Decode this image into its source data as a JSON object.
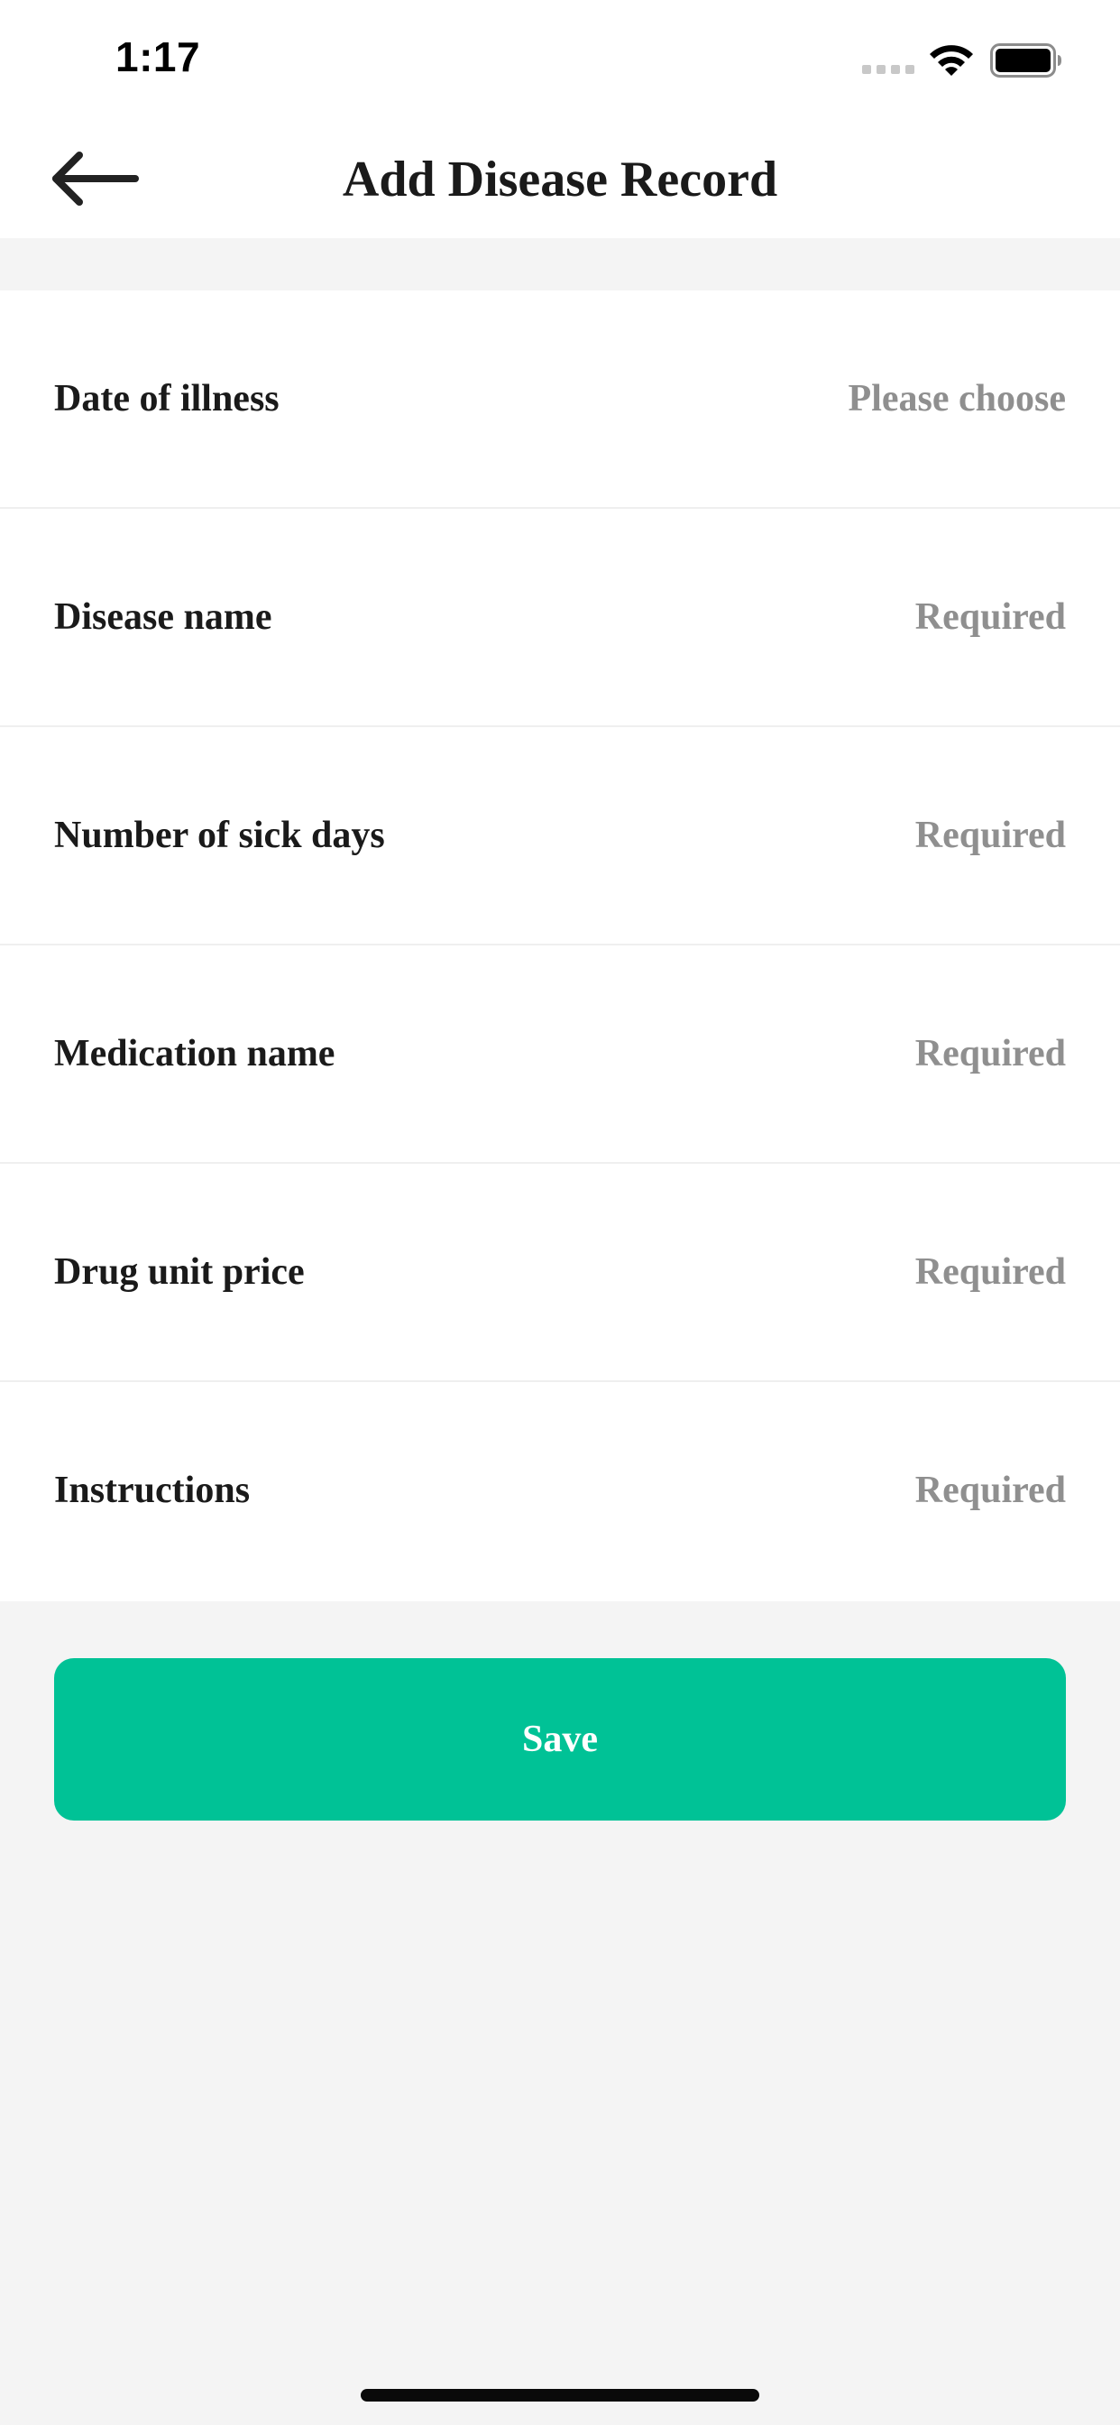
{
  "status_bar": {
    "time": "1:17",
    "icons": [
      "signal-dots-icon",
      "wifi-icon",
      "battery-icon"
    ]
  },
  "header": {
    "back_icon": "arrow-left-icon",
    "title": "Add Disease Record"
  },
  "form": {
    "rows": [
      {
        "label": "Date of illness",
        "placeholder": "Please choose"
      },
      {
        "label": "Disease name",
        "placeholder": "Required"
      },
      {
        "label": "Number of sick days",
        "placeholder": "Required"
      },
      {
        "label": "Medication name",
        "placeholder": "Required"
      },
      {
        "label": "Drug unit price",
        "placeholder": "Required"
      },
      {
        "label": "Instructions",
        "placeholder": "Required"
      }
    ]
  },
  "actions": {
    "save_label": "Save"
  },
  "colors": {
    "accent": "#00c296",
    "page_background": "#f4f4f4",
    "placeholder_text": "#8f8f8f",
    "label_text": "#1a1a1a"
  }
}
